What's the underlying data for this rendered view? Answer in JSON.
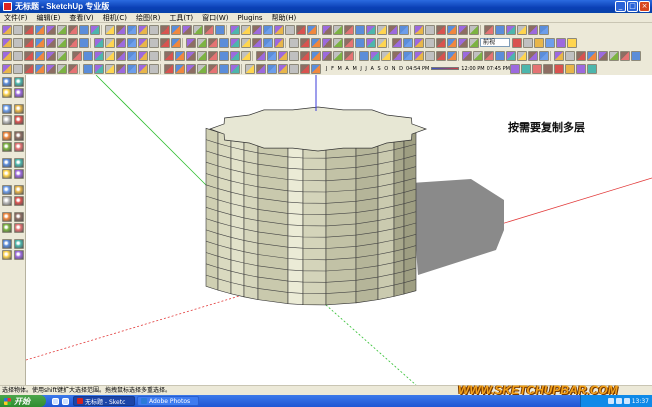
{
  "window": {
    "title": "无标题 - SketchUp 专业版",
    "min_label": "_",
    "max_label": "□",
    "close_label": "×"
  },
  "menu": [
    "文件(F)",
    "编辑(E)",
    "查看(V)",
    "相机(C)",
    "绘图(R)",
    "工具(T)",
    "窗口(W)",
    "Plugins",
    "帮助(H)"
  ],
  "toolbar": {
    "scene_select": "前视",
    "shadow_months": "J F M A M J J A S O N D",
    "time_left": "04:54 PM",
    "time_mid": "12:00 PM",
    "time_right": "07:45 PM"
  },
  "canvas": {
    "annotation": "按需要复制多层",
    "floor_count": 14
  },
  "status": {
    "text": "选择物体。使用shift键扩大选择范围。拖拽鼠标选择多重选择。"
  },
  "watermark": "WWW.SKETCHUPBAR.COM",
  "taskbar": {
    "start_label": "开始",
    "tasks": [
      {
        "label": "无标题 - Sketc",
        "active": true,
        "icon_color": "#d22222"
      },
      {
        "label": "Adobe Photos",
        "active": false,
        "icon_color": "#2b7bd8"
      }
    ],
    "clock": "13:37"
  },
  "colors": {
    "tower_face": "#dcdcc2",
    "tower_side": "#a9a98d",
    "tower_top": "#e7e7d4",
    "shadow": "#8a8a8a",
    "red_axis": "#e23b3b",
    "green_axis": "#2fbf2f",
    "blue_axis": "#3b3bd9"
  }
}
